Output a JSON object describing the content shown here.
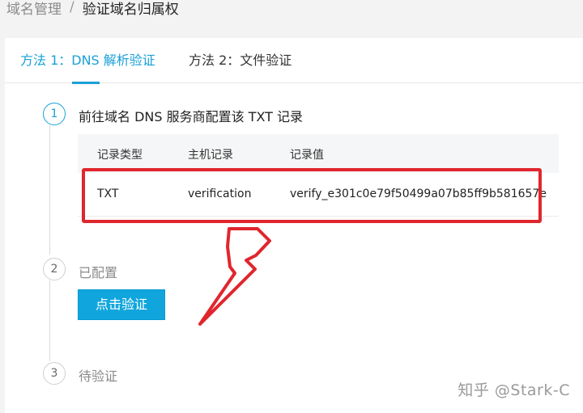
{
  "breadcrumb": {
    "parent": "域名管理",
    "separator": "/",
    "current": "验证域名归属权"
  },
  "tabs": [
    {
      "label": "方法 1：DNS 解析验证",
      "active": true
    },
    {
      "label": "方法 2：文件验证",
      "active": false
    }
  ],
  "steps": [
    {
      "number": "1",
      "title": "前往域名 DNS 服务商配置该 TXT 记录"
    },
    {
      "number": "2",
      "title": "已配置"
    },
    {
      "number": "3",
      "title": "待验证"
    }
  ],
  "records_table": {
    "columns": [
      "记录类型",
      "主机记录",
      "记录值"
    ],
    "rows": [
      [
        "TXT",
        "verification",
        "verify_e301c0e79f50499a07b85ff9b581657e"
      ]
    ]
  },
  "verify_button": {
    "label": "点击验证"
  },
  "annotation": {
    "color": "#e0262d",
    "icon": "red-arrow-icon"
  },
  "accent_color": "#1aa0d8",
  "watermark": "知乎 @Stark-C"
}
